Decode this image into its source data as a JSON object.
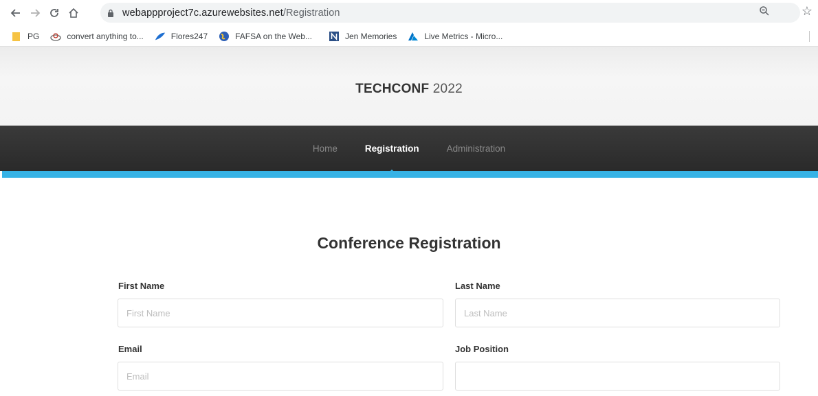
{
  "browser": {
    "url_host": "webappproject7c.azurewebsites.net",
    "url_path": "/Registration",
    "bookmarks": [
      {
        "label": "PG",
        "icon": "folder-icon"
      },
      {
        "label": "convert anything to...",
        "icon": "convert-site-icon"
      },
      {
        "label": "Flores247",
        "icon": "leaf-icon"
      },
      {
        "label": "FAFSA on the Web...",
        "icon": "globe-icon"
      },
      {
        "label": "Jen Memories",
        "icon": "notion-icon"
      },
      {
        "label": "Live Metrics - Micro...",
        "icon": "azure-icon"
      }
    ]
  },
  "site": {
    "brand_bold": "TECHCONF",
    "brand_year": "2022",
    "nav": [
      {
        "label": "Home",
        "active": false
      },
      {
        "label": "Registration",
        "active": true
      },
      {
        "label": "Administration",
        "active": false
      }
    ],
    "accent_color": "#37b3e6"
  },
  "form": {
    "title": "Conference Registration",
    "fields": [
      {
        "label": "First Name",
        "placeholder": "First Name",
        "value": ""
      },
      {
        "label": "Last Name",
        "placeholder": "Last Name",
        "value": ""
      },
      {
        "label": "Email",
        "placeholder": "Email",
        "value": ""
      },
      {
        "label": "Job Position",
        "placeholder": "",
        "value": ""
      }
    ]
  }
}
